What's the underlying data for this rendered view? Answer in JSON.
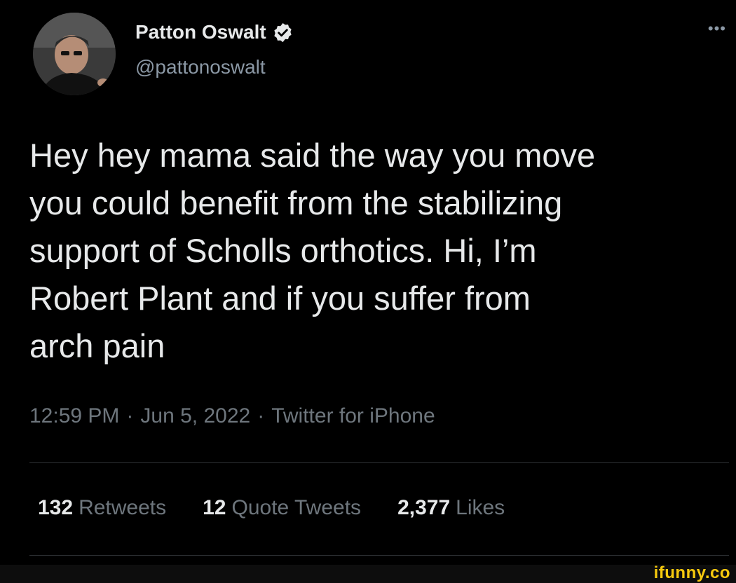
{
  "author": {
    "display_name": "Patton Oswalt",
    "handle": "@pattonoswalt",
    "verified": true,
    "avatar_icon": "profile-photo"
  },
  "menu": {
    "more_label": "•••"
  },
  "tweet": {
    "text": "Hey hey mama said the way you move\nyou could benefit from the stabilizing\nsupport of Scholls orthotics. Hi, I’m\nRobert Plant and if you suffer from\narch pain"
  },
  "meta": {
    "time": "12:59 PM",
    "separator": "·",
    "date": "Jun 5, 2022",
    "source": "Twitter for iPhone"
  },
  "stats": {
    "retweets_count": "132",
    "retweets_label": "Retweets",
    "quotes_count": "12",
    "quotes_label": "Quote Tweets",
    "likes_count": "2,377",
    "likes_label": "Likes"
  },
  "watermark": {
    "text": "ifunny.co"
  },
  "colors": {
    "background": "#000000",
    "primary_text": "#e7e9ea",
    "secondary_text": "#6e767d",
    "verified_badge": "#e7e9ea",
    "divider": "#2f3336",
    "watermark": "#f6c90e"
  }
}
